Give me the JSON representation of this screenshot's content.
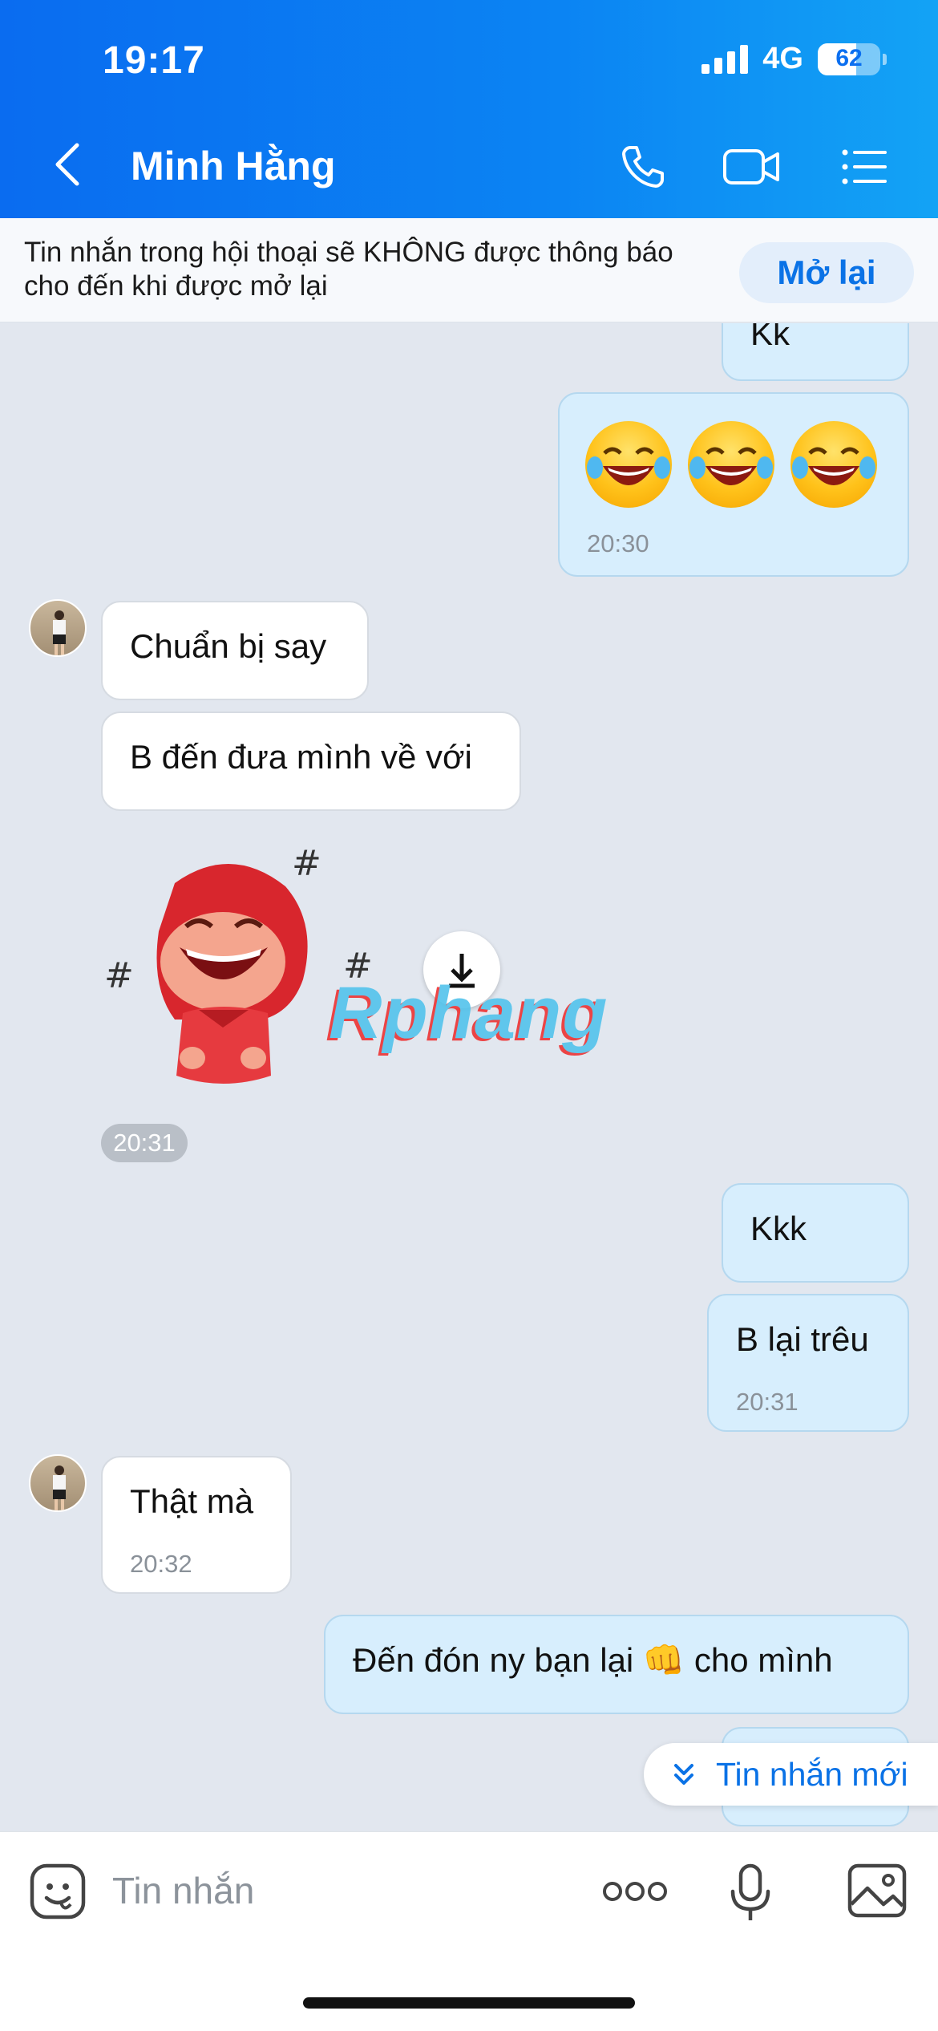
{
  "status_bar": {
    "time": "19:17",
    "network": "4G",
    "battery": "62"
  },
  "header": {
    "contact_name": "Minh Hằng"
  },
  "banner": {
    "line1": "Tin nhắn trong hội thoại sẽ KHÔNG được thông báo",
    "line2": "cho đến khi được mở lại",
    "button": "Mở lại"
  },
  "messages": [
    {
      "from": "me",
      "text": "Kk"
    },
    {
      "from": "me",
      "emojis": "😂😂😂",
      "time": "20:30"
    },
    {
      "from": "them",
      "text": "Chuẩn bị say"
    },
    {
      "from": "them",
      "text": "B đến đưa mình về với"
    },
    {
      "from": "them",
      "sticker": "laughing-red-hood-sticker",
      "time": "20:31"
    },
    {
      "from": "me",
      "text": "Kkk"
    },
    {
      "from": "me",
      "text": "B lại trêu",
      "time": "20:31"
    },
    {
      "from": "them",
      "text": "Thật mà",
      "time": "20:32"
    },
    {
      "from": "me",
      "text": "Đến đón ny bạn lại 👊 cho mình"
    }
  ],
  "watermark": "Rphang",
  "new_messages_label": "Tin nhắn mới",
  "input": {
    "placeholder": "Tin nhắn"
  },
  "colors": {
    "accent": "#0a72e6",
    "my_bubble": "#d7eefd",
    "chat_bg": "#e2e7ef"
  }
}
